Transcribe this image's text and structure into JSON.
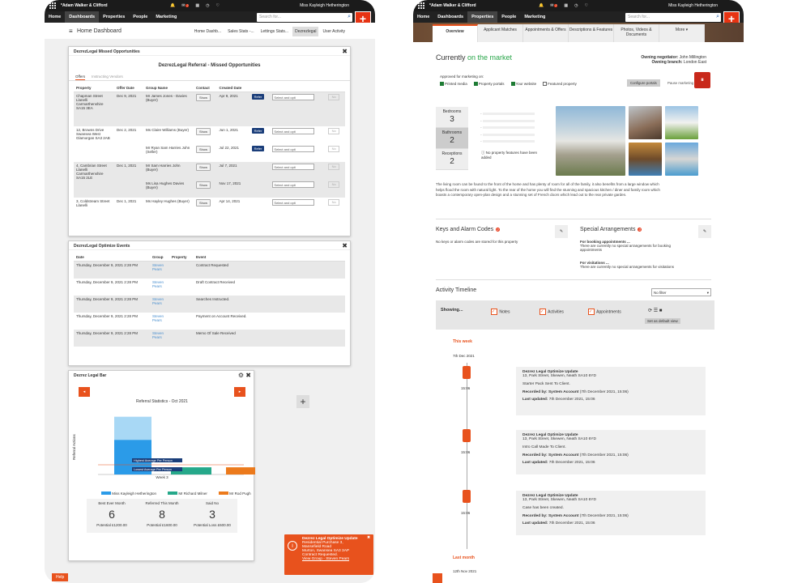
{
  "app": {
    "brand": "*Adam Walker & Clifford",
    "user": "Miss Kayleigh Hetherington",
    "nav": [
      "Home",
      "Dashboards",
      "Properties",
      "People",
      "Marketing"
    ],
    "search_placeholder": "Search for...",
    "plus": "+"
  },
  "left": {
    "dashboard_title": "Home Dashboard",
    "dash_tabs": [
      "Home Dashb...",
      "Sales Stats -...",
      "Lettings Stats...",
      "Dezrezlegal",
      "User Activity"
    ],
    "missed": {
      "title": "DezrezLegal Missed Opportunities",
      "heading": "DezrezLegal Referral - Missed Opportunities",
      "subtabs": [
        "Offers",
        "Instructing Vendors"
      ],
      "columns": [
        "Property",
        "Offer Date",
        "Group Name",
        "Contact",
        "Created Date"
      ],
      "rows": [
        {
          "property": "Chapman Street Llanelli Carmarthenshire SA15 3EA",
          "offer_date": "Dec 9, 2021",
          "group": "Mr James Jones - Davies (Buyer)",
          "contact": "Show",
          "created": "Apr 9, 2021"
        },
        {
          "property": "12, Browns Drive Swansea West Glamorgan SA3 2AB",
          "offer_date": "Dec 2, 2021",
          "group": "Ms Claire Williams (Buyer)",
          "contact": "Show",
          "created": "Jun 1, 2021"
        },
        {
          "property": "",
          "offer_date": "",
          "group": "Mr Ryan Sam Harries John (Seller)",
          "contact": "Show",
          "created": "Jul 22, 2021"
        },
        {
          "property": "4, Cambrian Street Llanelli Carmarthenshire SA15 2LE",
          "offer_date": "Dec 1, 2021",
          "group": "Mr Sam Harries John (Buyer)",
          "contact": "Show",
          "created": "Jul 7, 2021"
        },
        {
          "property": "",
          "offer_date": "",
          "group": "Ms Lisa Hughes Davies (Buyer)",
          "contact": "Show",
          "created": "Nov 17, 2021"
        },
        {
          "property": "3, Coldstream Street Llanelli",
          "offer_date": "Dec 1, 2021",
          "group": "Ms Hayley Hughes (Buyer)",
          "contact": "Show",
          "created": "Apr 14, 2021"
        }
      ],
      "refer": "Refer",
      "select": "Select and opti",
      "no": "No"
    },
    "events": {
      "title": "DezrezLegal Optimize Events",
      "columns": [
        "Date",
        "Group",
        "Property",
        "Event"
      ],
      "rows": [
        {
          "date": "Thursday, December 9, 2021 2:28 PM",
          "group": "Steven Pears",
          "event": "Contract Requested"
        },
        {
          "date": "Thursday, December 9, 2021 2:28 PM",
          "group": "Steven Pears",
          "event": "Draft Contract Received"
        },
        {
          "date": "Thursday, December 9, 2021 2:28 PM",
          "group": "Steven Pears",
          "event": "Searches Instructed."
        },
        {
          "date": "Thursday, December 9, 2021 2:28 PM",
          "group": "Steven Pears",
          "event": "Payment on Account Received."
        },
        {
          "date": "Thursday, December 9, 2021 2:28 PM",
          "group": "Steven Pears",
          "event": "Memo Of Sale Received"
        }
      ]
    },
    "bar": {
      "title": "Dezrez Legal Bar",
      "chart_title": "Referral Statistics - Oct 2021",
      "ylabel": "Referral Actions",
      "xlabel": "Week 3",
      "highest": "Highest Average Per Person",
      "lowest": "Lowest Average Per Person",
      "legend": [
        "Miss Kayleigh Hetherington",
        "Mr Richard Milner",
        "Mr Rod Pugh"
      ],
      "legend_colors": [
        "#2b9be8",
        "#26a88a",
        "#ec7a1c"
      ],
      "stats": [
        {
          "label": "Best Ever Month",
          "value": "6",
          "potential": "Potential £1200.00"
        },
        {
          "label": "Referred This Month",
          "value": "8",
          "potential": "Potential £1600.00"
        },
        {
          "label": "Said No",
          "value": "3",
          "potential": "Potential Loss £600.00"
        }
      ]
    },
    "toast": {
      "title": "Dezrez Legal Optimize Update",
      "lines": [
        "Residential Purchase 3,",
        "Mansefield Road",
        "Murton, Swansea SA3 3AP",
        "Contract Requested."
      ],
      "link": "View Group - Steven Pears"
    },
    "help": "Help"
  },
  "right": {
    "tabs": [
      "Overview",
      "Applicant Matches",
      "Appointments & Offers",
      "Descriptions & Features",
      "Photos, Videos & Documents",
      "More"
    ],
    "status_prefix": "Currently",
    "status": "on the market",
    "negotiator_label": "Owning negotiator:",
    "negotiator": "John Millington",
    "branch_label": "Owning branch:",
    "branch": "London East",
    "approved": "Approved for marketing on:",
    "marketing": [
      "Printed media",
      "Property portals",
      "Your website",
      "Featured property"
    ],
    "configure": "Configure portals",
    "pause": "Pause marketing",
    "rooms": [
      {
        "label": "Bedrooms",
        "value": "3"
      },
      {
        "label": "Bathrooms",
        "value": "2"
      },
      {
        "label": "Receptions",
        "value": "2"
      }
    ],
    "no_features": "No property features have been added",
    "description": "The living room can be found to the front of the home and has plenty of room for all of the family, it also benefits from a large window which helps flood the room with natural light. To the rear of the home you will find the stunning and spacious kitchen / diner and family room which boasts a contemporary open-plan design and a stunning set of French doors which lead out to the rear private garden.",
    "keys_title": "Keys and Alarm Codes",
    "keys_badge": "0",
    "keys_text": "No keys or alarm codes are stored for this property",
    "special_title": "Special Arrangements",
    "special_badge": "0",
    "booking_title": "For booking appointments ...",
    "booking_text": "There are currently no special arrangements for booking appointments",
    "visit_title": "For visitations ...",
    "visit_text": "There are currently no special arrangements for visitations",
    "timeline_title": "Activity Timeline",
    "filter": "No filter",
    "showing": "Showing...",
    "filters": [
      "Notes",
      "Activities",
      "Appointments"
    ],
    "default_view": "Set as default view",
    "this_week": "This week",
    "date1": "7th Dec 2021",
    "entries": [
      {
        "time": "15:06",
        "title": "Dezrez Legal Optimize Update",
        "addr": "13, Park Street, Skewen, Neath SA10 6YD",
        "body": "Starter Pack Sent To Client.",
        "recorded": "Recorded by: System Account",
        "recorded_date": "(7th December 2021, 15:06)",
        "updated": "Last updated:",
        "updated_date": "7th December 2021, 15:06"
      },
      {
        "time": "15:06",
        "title": "Dezrez Legal Optimize Update",
        "addr": "13, Park Street, Skewen, Neath SA10 6YD",
        "body": "Intro Call Made To Client.",
        "recorded": "Recorded by: System Account",
        "recorded_date": "(7th December 2021, 15:06)",
        "updated": "Last updated:",
        "updated_date": "7th December 2021, 15:06"
      },
      {
        "time": "15:06",
        "title": "Dezrez Legal Optimize Update",
        "addr": "13, Park Street, Skewen, Neath SA10 6YD",
        "body": "Case has been created.",
        "recorded": "Recorded by: System Account",
        "recorded_date": "(7th December 2021, 15:06)",
        "updated": "Last updated:",
        "updated_date": "7th December 2021, 15:06"
      }
    ],
    "last_month": "Last month",
    "date2": "12th Nov 2021"
  },
  "chart_data": {
    "type": "bar",
    "title": "Referral Statistics - Oct 2021",
    "ylabel": "Referral Actions",
    "xlabel": "Week 3",
    "categories": [
      "Week 3"
    ],
    "series": [
      {
        "name": "Miss Kayleigh Hetherington",
        "values": [
          8
        ]
      },
      {
        "name": "Mr Richard Milner",
        "values": [
          1
        ]
      },
      {
        "name": "Mr Rod Pugh",
        "values": [
          1
        ]
      }
    ],
    "ylim": [
      0,
      9
    ],
    "legend": "bottom"
  }
}
